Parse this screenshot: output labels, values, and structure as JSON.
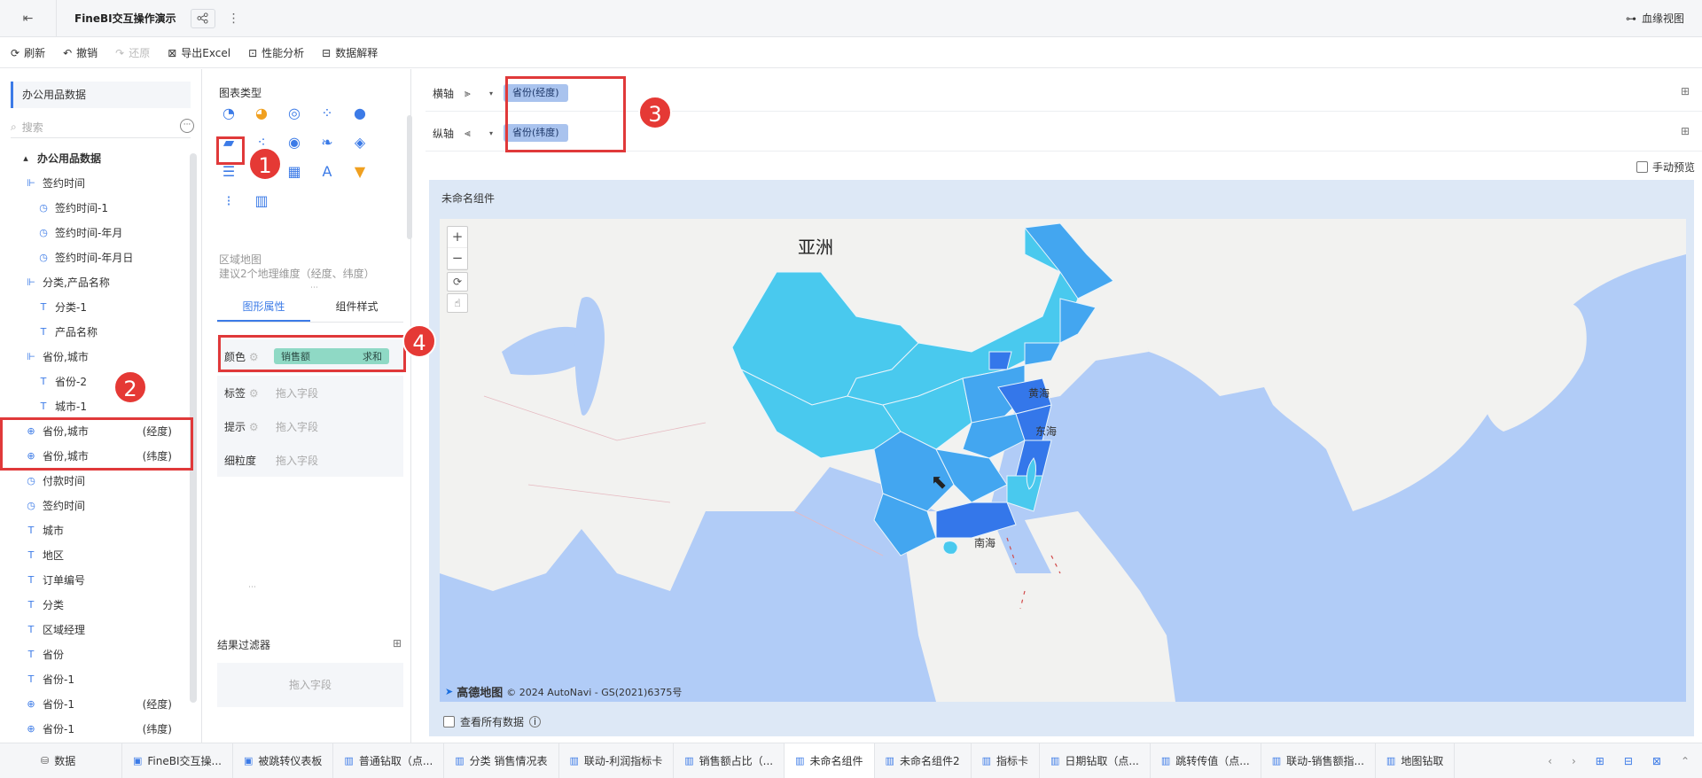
{
  "titlebar": {
    "title": "FineBI交互操作演示",
    "lineage": "血缘视图"
  },
  "toolbar": {
    "refresh": "刷新",
    "undo": "撤销",
    "redo": "还原",
    "export_excel": "导出Excel",
    "perf": "性能分析",
    "explain": "数据解释"
  },
  "datapanel": {
    "dataset": "办公用品数据",
    "search_placeholder": "搜索",
    "tree": [
      {
        "label": "办公用品数据",
        "icon": "caret-down-icon",
        "level": 0
      },
      {
        "label": "签约时间",
        "icon": "hierarchy-icon",
        "level": 1
      },
      {
        "label": "签约时间-1",
        "icon": "clock-icon",
        "level": 2
      },
      {
        "label": "签约时间-年月",
        "icon": "clock-icon",
        "level": 2
      },
      {
        "label": "签约时间-年月日",
        "icon": "clock-icon",
        "level": 2
      },
      {
        "label": "分类,产品名称",
        "icon": "hierarchy-icon",
        "level": 1
      },
      {
        "label": "分类-1",
        "icon": "text-icon",
        "level": 2
      },
      {
        "label": "产品名称",
        "icon": "text-icon",
        "level": 2
      },
      {
        "label": "省份,城市",
        "icon": "hierarchy-icon",
        "level": 1
      },
      {
        "label": "省份-2",
        "icon": "text-icon",
        "level": 2
      },
      {
        "label": "城市-1",
        "icon": "text-icon",
        "level": 2
      },
      {
        "label": "省份,城市",
        "suffix": "(经度)",
        "icon": "globe-icon",
        "level": 1
      },
      {
        "label": "省份,城市",
        "suffix": "(纬度)",
        "icon": "globe-icon",
        "level": 1
      },
      {
        "label": "付款时间",
        "icon": "clock-icon",
        "level": 1
      },
      {
        "label": "签约时间",
        "icon": "clock-icon",
        "level": 1
      },
      {
        "label": "城市",
        "icon": "text-icon",
        "level": 1
      },
      {
        "label": "地区",
        "icon": "text-icon",
        "level": 1
      },
      {
        "label": "订单编号",
        "icon": "text-icon",
        "level": 1
      },
      {
        "label": "分类",
        "icon": "text-icon",
        "level": 1
      },
      {
        "label": "区域经理",
        "icon": "text-icon",
        "level": 1
      },
      {
        "label": "省份",
        "icon": "text-icon",
        "level": 1
      },
      {
        "label": "省份-1",
        "icon": "text-icon",
        "level": 1
      },
      {
        "label": "省份-1",
        "suffix": "(经度)",
        "icon": "globe-icon",
        "level": 1
      },
      {
        "label": "省份-1",
        "suffix": "(纬度)",
        "icon": "globe-icon",
        "level": 1
      }
    ]
  },
  "chartpanel": {
    "section_title": "图表类型",
    "selected_name": "区域地图",
    "selected_hint": "建议2个地理维度（经度、纬度）",
    "tabs": [
      "图形属性",
      "组件样式"
    ],
    "props": {
      "color": "颜色",
      "label": "标签",
      "tooltip": "提示",
      "granularity": "细粒度",
      "drop_placeholder": "拖入字段",
      "color_field": "销售额",
      "color_agg": "求和"
    },
    "filter_title": "结果过滤器",
    "filter_placeholder": "拖入字段"
  },
  "axes": {
    "x_label": "横轴",
    "x_field": "省份(经度)",
    "y_label": "纵轴",
    "y_field": "省份(纬度)",
    "manual_preview": "手动预览"
  },
  "component": {
    "name": "未命名组件",
    "map_labels": {
      "asia": "亚洲",
      "yellow_sea": "黄海",
      "east_sea": "东海",
      "south_sea": "南海"
    },
    "attribution_logo": "高德地图",
    "attribution": "© 2024 AutoNavi - GS(2021)6375号",
    "view_all": "查看所有数据"
  },
  "badges": [
    "1",
    "2",
    "3",
    "4"
  ],
  "bottom_tabs": [
    {
      "label": "数据",
      "icon": "database-icon"
    },
    {
      "label": "FineBI交互操...",
      "icon": "dashboard-icon"
    },
    {
      "label": "被跳转仪表板",
      "icon": "dashboard-icon"
    },
    {
      "label": "普通钻取（点...",
      "icon": "chart-icon"
    },
    {
      "label": "分类 销售情况表",
      "icon": "chart-icon"
    },
    {
      "label": "联动-利润指标卡",
      "icon": "chart-icon"
    },
    {
      "label": "销售额占比（...",
      "icon": "chart-icon"
    },
    {
      "label": "未命名组件",
      "icon": "chart-icon",
      "active": true
    },
    {
      "label": "未命名组件2",
      "icon": "chart-icon"
    },
    {
      "label": "指标卡",
      "icon": "chart-icon"
    },
    {
      "label": "日期钻取（点...",
      "icon": "chart-icon"
    },
    {
      "label": "跳转传值（点...",
      "icon": "chart-icon"
    },
    {
      "label": "联动-销售额指...",
      "icon": "chart-icon"
    },
    {
      "label": "地图钻取",
      "icon": "chart-icon"
    }
  ],
  "colors": {
    "accent": "#3c7be7",
    "annotation": "#e0393a",
    "map_water": "#b1ccf7",
    "map_land": "#f2f2f0",
    "region_light": "#49c9ee",
    "region_mid": "#43a6f0",
    "region_dark": "#3477ea"
  }
}
